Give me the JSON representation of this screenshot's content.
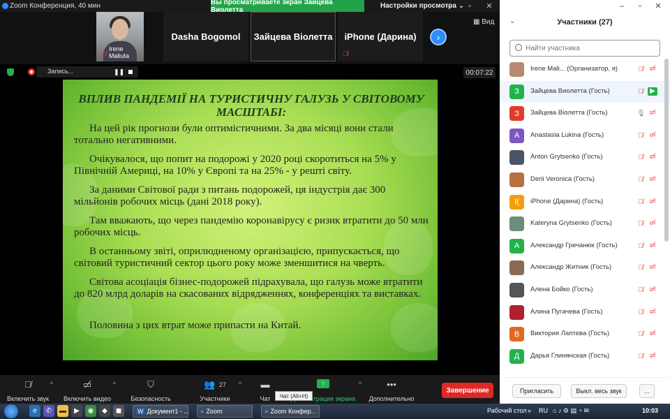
{
  "window": {
    "title": "Zoom Конференция, 40 мин",
    "share_banner": "Вы просматриваете экран Зайцева Виолетта",
    "view_options": "Настройки просмотра",
    "view_label": "Вид"
  },
  "video_strip": {
    "self_name": "Irene Maliuta",
    "tiles": [
      {
        "name": "Dasha Bogomol"
      },
      {
        "name": "Зайцева Віолетта"
      },
      {
        "name": "iPhone (Дарина)"
      }
    ]
  },
  "recording": {
    "label": "Запись...",
    "timer": "00:07:22"
  },
  "slide": {
    "title": "ВПЛИВ ПАНДЕМІЇ НА ТУРИСТИЧНУ ГАЛУЗЬ У СВІТОВОМУ МАСШТАБІ:",
    "paragraphs": [
      "На цей рік прогнози були оптимістичними. За два місяці вони стали тотально негативними.",
      "Очікувалося, що попит на подорожі у 2020 році скоротиться на 5% у Північній Америці, на 10% у Європі та на 25% - у решті світу.",
      "За даними Світової ради з питань подорожей, ця індустрія дає 300 мільйонів робочих місць (дані 2018 року).",
      "Там вважають, що через пандемію коронавірусу є ризик втратити до 50 млн робочих місць.",
      "В останньому звіті, оприлюдненому організацією, припускається, що світовий туристичний сектор цього року може зменшитися на чверть.",
      "Світова асоціація бізнес-подорожей підрахувала, що галузь може втратити до 820 млрд доларів на скасованих відрядженнях, конференціях та виставках.",
      "Половина з цих втрат може припасти на Китай."
    ]
  },
  "toolbar": {
    "audio": "Включить звук",
    "video": "Включить видео",
    "security": "Безопасность",
    "participants": "Участники",
    "participants_count": "27",
    "chat": "Чат",
    "share": "Демонстрация экрана",
    "more": "Дополнительно",
    "end": "Завершение",
    "chat_tooltip": "Чат (Alt+H)"
  },
  "panel": {
    "title": "Участники (27)",
    "search_placeholder": "Найти участника",
    "invite": "Пригласить",
    "mute_all": "Выкл. весь звук",
    "more": "..."
  },
  "participants": [
    {
      "name": "Irene Mali... (Организатор, я)",
      "avatar": "",
      "color": "#b98a6d",
      "cam_on": false,
      "mic": "off"
    },
    {
      "name": "Зайцева Виолетта (Гость)",
      "avatar": "З",
      "color": "#23b24a",
      "cam_on": true,
      "mic": "off"
    },
    {
      "name": "Зайцева Віолетта (Гость)",
      "avatar": "З",
      "color": "#e03b2b",
      "cam_on": false,
      "mic": "on"
    },
    {
      "name": "Anastasia Lukina (Гость)",
      "avatar": "A",
      "color": "#7e57c2",
      "cam_on": false,
      "mic": "off"
    },
    {
      "name": "Anton Grytsenko (Гость)",
      "avatar": "",
      "color": "#4a5568",
      "cam_on": false,
      "mic": "off"
    },
    {
      "name": "Derii Veronica (Гость)",
      "avatar": "",
      "color": "#b5713f",
      "cam_on": false,
      "mic": "off"
    },
    {
      "name": "iPhone (Дарина) (Гость)",
      "avatar": "I(",
      "color": "#f59e0b",
      "cam_on": false,
      "mic": "off"
    },
    {
      "name": "Kateryna Grytsenko (Гость)",
      "avatar": "",
      "color": "#6b8e7a",
      "cam_on": false,
      "mic": "off"
    },
    {
      "name": "Александр Гречанюк (Гость)",
      "avatar": "A",
      "color": "#23b24a",
      "cam_on": false,
      "mic": "off"
    },
    {
      "name": "Александр Житник (Гость)",
      "avatar": "",
      "color": "#8a6a56",
      "cam_on": false,
      "mic": "off"
    },
    {
      "name": "Алена Бойко (Гость)",
      "avatar": "",
      "color": "#555",
      "cam_on": false,
      "mic": "off"
    },
    {
      "name": "Алина Пугачева (Гость)",
      "avatar": "",
      "color": "#b0202f",
      "cam_on": false,
      "mic": "off"
    },
    {
      "name": "Виктория Лаптева (Гость)",
      "avatar": "B",
      "color": "#e06a1f",
      "cam_on": false,
      "mic": "off"
    },
    {
      "name": "Дарья Глинянская (Гость)",
      "avatar": "Д",
      "color": "#23b24a",
      "cam_on": false,
      "mic": "off"
    }
  ],
  "taskbar": {
    "tasks": [
      "Документ1 - ...",
      "Zoom",
      "Zoom Конфер..."
    ],
    "desktop": "Рабочий стол",
    "lang": "RU",
    "clock": "10:03"
  }
}
